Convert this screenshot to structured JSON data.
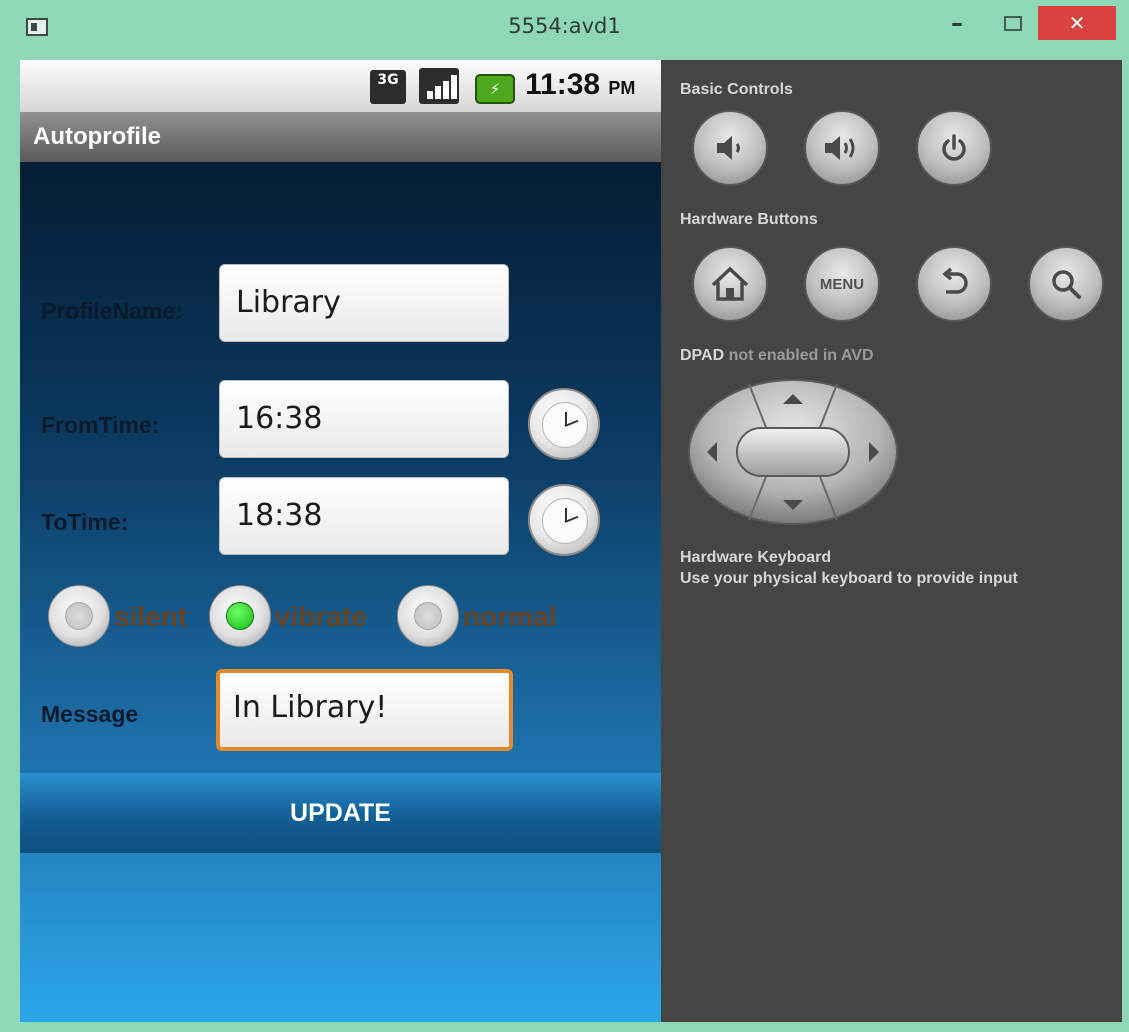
{
  "window": {
    "title": "5554:avd1",
    "minimize_glyph": "–",
    "close_glyph": "✕"
  },
  "statusbar": {
    "network": "3G",
    "battery_glyph": "⚡",
    "time": "11:38",
    "ampm": "PM"
  },
  "app": {
    "title": "Autoprofile",
    "profile_label": "ProfileName:",
    "profile_value": "Library",
    "from_label": "FromTime:",
    "from_value": "16:38",
    "to_label": "ToTime:",
    "to_value": "18:38",
    "modes": [
      {
        "label": "silent",
        "checked": false
      },
      {
        "label": "vibrate",
        "checked": true
      },
      {
        "label": "normal",
        "checked": false
      }
    ],
    "message_label": "Message",
    "message_value": "In Library!",
    "update_label": "UPDATE"
  },
  "panel": {
    "basic_controls": "Basic Controls",
    "hardware_buttons": "Hardware Buttons",
    "menu_label": "MENU",
    "dpad_bold": "DPAD",
    "dpad_rest": " not enabled in AVD",
    "keyboard_title": "Hardware Keyboard",
    "keyboard_desc": "Use your physical keyboard to provide input"
  },
  "icons": [
    "app-icon",
    "volume-down-icon",
    "volume-up-icon",
    "power-icon",
    "home-icon",
    "back-icon",
    "search-icon",
    "clock-icon",
    "signal-icon",
    "battery-icon"
  ],
  "colors": {
    "accent": "#e58a28",
    "radio_checked": "#15b814",
    "close": "#d9423e"
  }
}
